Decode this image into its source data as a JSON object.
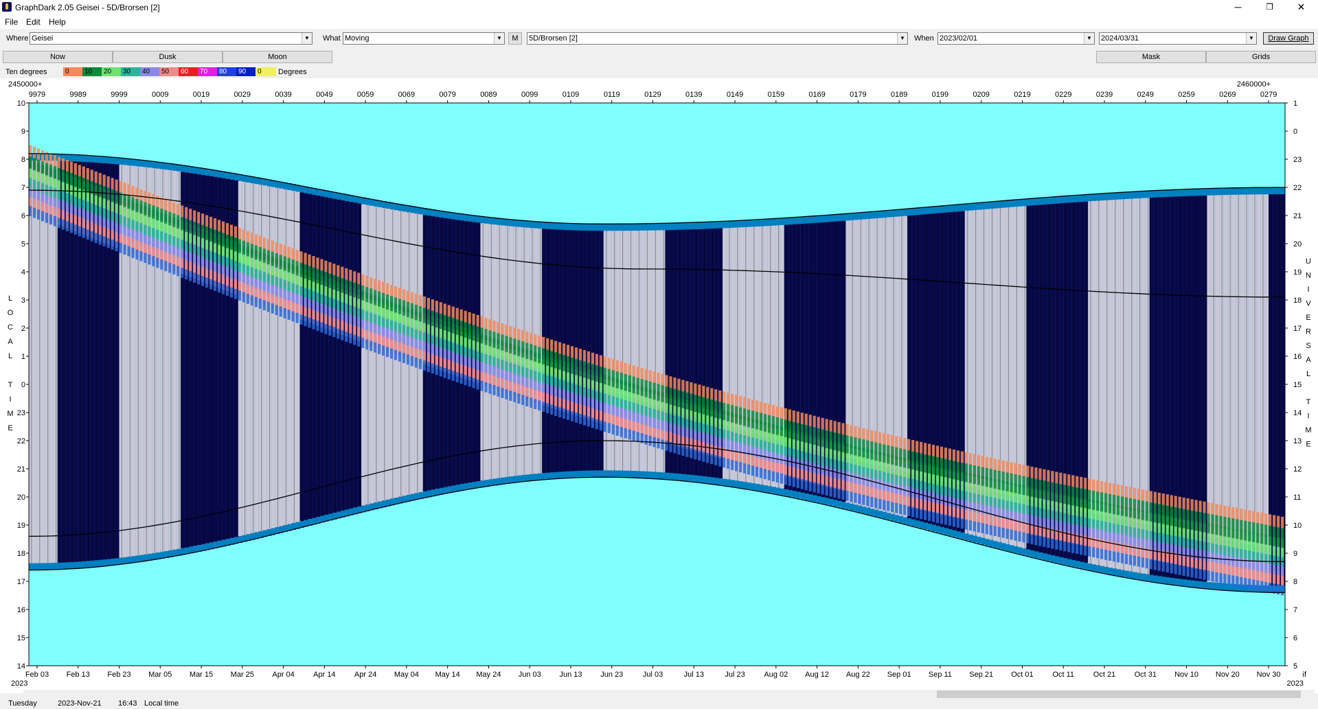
{
  "window": {
    "title": "GraphDark 2.05  Geisei  -  5D/Brorsen [2]",
    "minimize": "─",
    "restore": "❐",
    "close": "✕"
  },
  "menu": [
    "File",
    "Edit",
    "Help"
  ],
  "toolbar": {
    "where_label": "Where",
    "where_value": "Geisei",
    "what_label": "What",
    "what_value": "Moving",
    "m_button": "M",
    "object_value": "5D/Brorsen [2]",
    "when_label": "When",
    "from_date": "2023/02/01",
    "to_date": "2024/03/31",
    "draw_button": "Draw Graph"
  },
  "buttons": {
    "now": "Now",
    "dusk": "Dusk",
    "moon": "Moon",
    "mask": "Mask",
    "grids": "Grids"
  },
  "legend": {
    "left_label": "Ten degrees",
    "right_label": "Degrees",
    "items": [
      {
        "label": "0",
        "color": "#f58a58"
      },
      {
        "label": "10",
        "color": "#0a8a3a"
      },
      {
        "label": "20",
        "color": "#6ee36e"
      },
      {
        "label": "30",
        "color": "#2cb49a"
      },
      {
        "label": "40",
        "color": "#8a8ae8"
      },
      {
        "label": "50",
        "color": "#f08a8a"
      },
      {
        "label": "60",
        "color": "#e82020"
      },
      {
        "label": "70",
        "color": "#e020e0"
      },
      {
        "label": "80",
        "color": "#2040e0"
      },
      {
        "label": "90",
        "color": "#0020c0"
      },
      {
        "label": "0",
        "color": "#f0f060"
      }
    ]
  },
  "chart_data": {
    "type": "heatmap",
    "jd_left_prefix": "2450000+",
    "jd_right_prefix": "2460000+",
    "jd_ticks": [
      "9979",
      "9989",
      "9999",
      "0009",
      "0019",
      "0029",
      "0039",
      "0049",
      "0059",
      "0069",
      "0079",
      "0089",
      "0099",
      "0109",
      "0119",
      "0129",
      "0139",
      "0149",
      "0159",
      "0169",
      "0179",
      "0189",
      "0199",
      "0209",
      "0219",
      "0229",
      "0239",
      "0249",
      "0259",
      "0269",
      "0279"
    ],
    "date_ticks": [
      "Feb 03",
      "Feb 13",
      "Feb 23",
      "Mar 05",
      "Mar 15",
      "Mar 25",
      "Apr 04",
      "Apr 14",
      "Apr 24",
      "May 04",
      "May 14",
      "May 24",
      "Jun 03",
      "Jun 13",
      "Jun 23",
      "Jul 03",
      "Jul 13",
      "Jul 23",
      "Aug 02",
      "Aug 12",
      "Aug 22",
      "Sep 01",
      "Sep 11",
      "Sep 21",
      "Oct 01",
      "Oct 11",
      "Oct 21",
      "Oct 31",
      "Nov 10",
      "Nov 20",
      "Nov 30"
    ],
    "year_left": "2023",
    "year_right": "2023",
    "corner_right": "if",
    "left_ticks": [
      "10",
      "9",
      "8",
      "7",
      "6",
      "5",
      "4",
      "3",
      "2",
      "1",
      "0",
      "23",
      "22",
      "21",
      "20",
      "19",
      "18",
      "17",
      "16",
      "15",
      "14"
    ],
    "right_ticks": [
      "1",
      "0",
      "23",
      "22",
      "21",
      "20",
      "19",
      "18",
      "17",
      "16",
      "15",
      "14",
      "13",
      "12",
      "11",
      "10",
      "9",
      "8",
      "7",
      "6",
      "5"
    ],
    "left_axis_label": [
      "L",
      "O",
      "C",
      "A",
      "L",
      "",
      "T",
      "I",
      "M",
      "E"
    ],
    "right_axis_label": [
      "U",
      "N",
      "I",
      "V",
      "E",
      "R",
      "S",
      "A",
      "L",
      "",
      "T",
      "I",
      "M",
      "E"
    ],
    "colors": {
      "daylight": "#80ffff",
      "night": "#080848",
      "moon": "#c8c8d8",
      "twilight": "#0080c0"
    }
  },
  "status": {
    "day": "Tuesday",
    "date": "2023-Nov-21",
    "time": "16:43",
    "zone": "Local time"
  }
}
